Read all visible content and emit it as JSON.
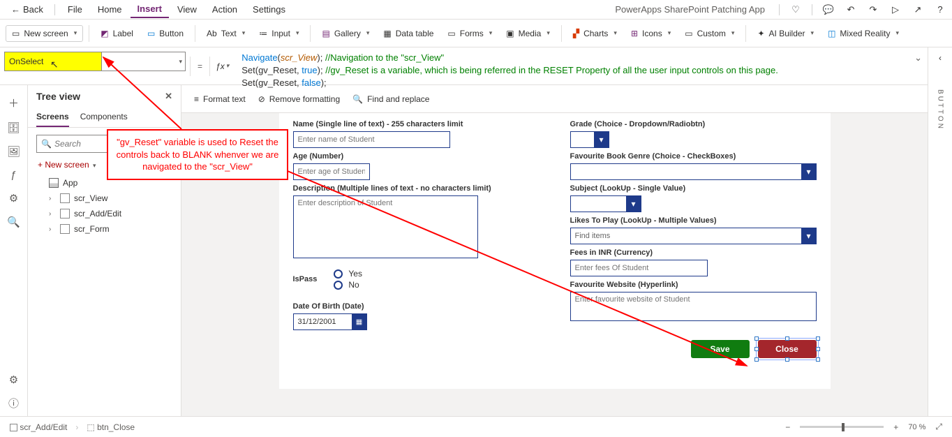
{
  "header": {
    "back": "Back",
    "menus": [
      "File",
      "Home",
      "Insert",
      "View",
      "Action",
      "Settings"
    ],
    "activeMenu": "Insert",
    "appTitle": "PowerApps SharePoint Patching App"
  },
  "ribbon": {
    "newScreen": "New screen",
    "items": [
      "Label",
      "Button",
      "Text",
      "Input",
      "Gallery",
      "Data table",
      "Forms",
      "Media",
      "Charts",
      "Icons",
      "Custom",
      "AI Builder",
      "Mixed Reality"
    ]
  },
  "propertySelector": "OnSelect",
  "formula": {
    "line1_nav": "Navigate",
    "line1_arg": "scr_View",
    "line1_rest": "); ",
    "line1_comment": "//Navigation to the \"scr_View\"",
    "line2_set": "Set(gv_Reset, ",
    "line2_true": "true",
    "line2_rest": "); ",
    "line2_comment": "//gv_Reset is a variable, which is being referred in the RESET Property of all the user input controls on this page.",
    "line3_set": "Set(gv_Reset, ",
    "line3_false": "false",
    "line3_rest": ");"
  },
  "formatBar": {
    "formatText": "Format text",
    "removeFormat": "Remove formatting",
    "findReplace": "Find and replace"
  },
  "tree": {
    "title": "Tree view",
    "tabs": [
      "Screens",
      "Components"
    ],
    "activeTab": "Screens",
    "searchPlaceholder": "Search",
    "newScreen": "New screen",
    "app": "App",
    "screens": [
      "scr_View",
      "scr_Add/Edit",
      "scr_Form"
    ]
  },
  "annotation": "\"gv_Reset\" variable is used to Reset the controls back to BLANK whenver we are navigated to the \"scr_View\"",
  "form": {
    "name_lbl": "Name (Single line of text) - 255 characters limit",
    "name_ph": "Enter name of Student",
    "age_lbl": "Age (Number)",
    "age_ph": "Enter age of Student",
    "desc_lbl": "Description (Multiple lines of text - no characters limit)",
    "desc_ph": "Enter description of Student",
    "ispass_lbl": "IsPass",
    "ispass_yes": "Yes",
    "ispass_no": "No",
    "dob_lbl": "Date Of Birth (Date)",
    "dob_val": "31/12/2001",
    "grade_lbl": "Grade (Choice - Dropdown/Radiobtn)",
    "genre_lbl": "Favourite Book Genre (Choice - CheckBoxes)",
    "subject_lbl": "Subject (LookUp - Single Value)",
    "likes_lbl": "Likes To Play (LookUp - Multiple Values)",
    "likes_ph": "Find items",
    "fees_lbl": "Fees in INR (Currency)",
    "fees_ph": "Enter fees Of Student",
    "website_lbl": "Favourite Website (Hyperlink)",
    "website_ph": "Enter favourite website of Student",
    "save_btn": "Save",
    "close_btn": "Close"
  },
  "rightRail": {
    "tab": "BUTTON"
  },
  "status": {
    "breadcrumb1": "scr_Add/Edit",
    "breadcrumb2": "btn_Close",
    "zoom": "70 %"
  }
}
